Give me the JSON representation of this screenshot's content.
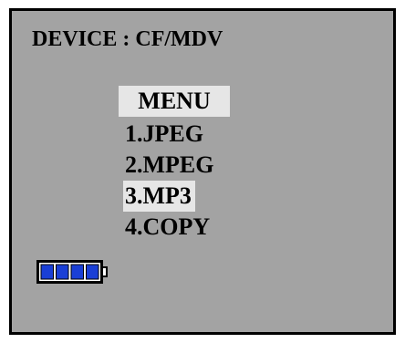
{
  "screen": {
    "device_label": "DEVICE",
    "device_separator": " : ",
    "device_value": "CF/MDV"
  },
  "menu": {
    "title": "MENU",
    "items": [
      {
        "label": "1.JPEG",
        "selected": false
      },
      {
        "label": "2.MPEG",
        "selected": false
      },
      {
        "label": "3.MP3",
        "selected": true
      },
      {
        "label": "4.COPY",
        "selected": false
      }
    ],
    "selected_index": 2
  },
  "battery": {
    "icon": "battery-icon",
    "level_fraction": 1.0,
    "segments_filled": 4,
    "segments_total": 4,
    "fill_color": "#1a3fd6"
  },
  "colors": {
    "screen_background": "#a3a3a3",
    "highlight": "#e6e6e6",
    "text": "#000000"
  }
}
